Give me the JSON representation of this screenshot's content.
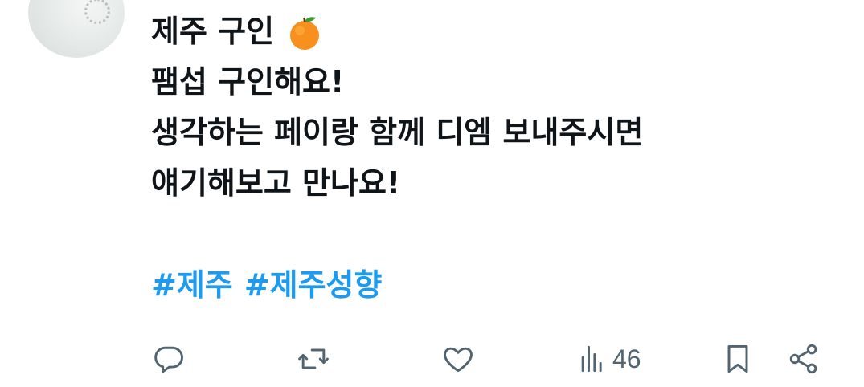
{
  "tweet": {
    "author_name": "제주 구인",
    "author_emoji": "tangerine-icon",
    "lines": [
      "팸섭 구인해요!",
      "생각하는 페이랑 함께 디엠 보내주시면",
      "얘기해보고 만나요!"
    ],
    "hashtags": [
      "#제주",
      "#제주성향"
    ]
  },
  "actions": {
    "reply_icon": "reply-icon",
    "retweet_icon": "retweet-icon",
    "like_icon": "heart-icon",
    "views_icon": "views-icon",
    "views_count": "46",
    "bookmark_icon": "bookmark-icon",
    "share_icon": "share-icon"
  },
  "colors": {
    "text": "#0f1419",
    "hashtag": "#1d9bf0",
    "icon": "#536471"
  }
}
